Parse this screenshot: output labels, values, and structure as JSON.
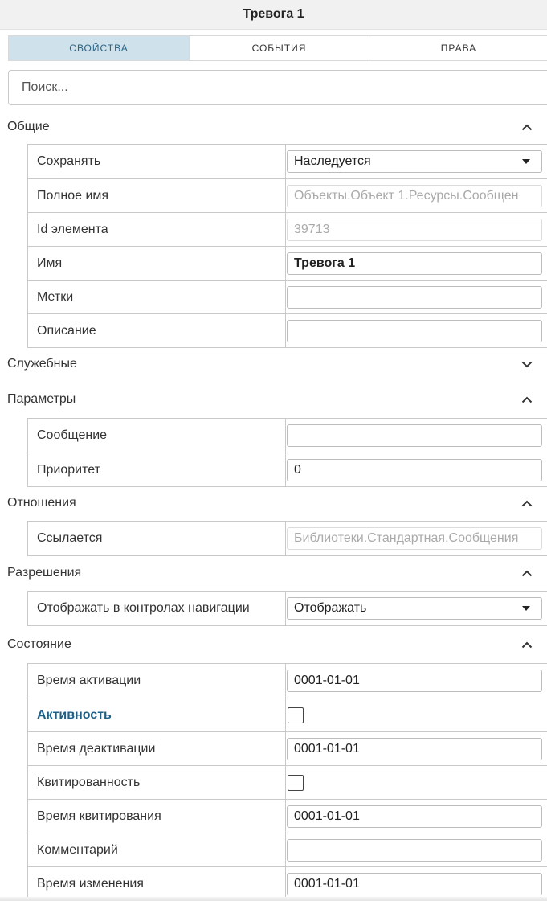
{
  "window": {
    "title": "Тревога 1"
  },
  "tabs": [
    {
      "label": "СВОЙСТВА"
    },
    {
      "label": "СОБЫТИЯ"
    },
    {
      "label": "ПРАВА"
    }
  ],
  "search": {
    "placeholder": "Поиск..."
  },
  "sections": {
    "general": {
      "title": "Общие",
      "expanded": true,
      "rows": {
        "save": {
          "label": "Сохранять",
          "value": "Наследуется"
        },
        "full_name": {
          "label": "Полное имя",
          "value": "Объекты.Объект 1.Ресурсы.Сообщен"
        },
        "element_id": {
          "label": "Id элемента",
          "value": "39713"
        },
        "name": {
          "label": "Имя",
          "value": "Тревога 1"
        },
        "tags": {
          "label": "Метки",
          "value": ""
        },
        "description": {
          "label": "Описание",
          "value": ""
        }
      }
    },
    "service": {
      "title": "Служебные",
      "expanded": false
    },
    "parameters": {
      "title": "Параметры",
      "expanded": true,
      "rows": {
        "message": {
          "label": "Сообщение",
          "value": ""
        },
        "priority": {
          "label": "Приоритет",
          "value": "0"
        }
      }
    },
    "relations": {
      "title": "Отношения",
      "expanded": true,
      "rows": {
        "refers": {
          "label": "Ссылается",
          "value": "Библиотеки.Стандартная.Сообщения"
        }
      }
    },
    "permissions": {
      "title": "Разрешения",
      "expanded": true,
      "rows": {
        "show_in_nav": {
          "label": "Отображать в контролах навигации",
          "value": "Отображать"
        }
      }
    },
    "state": {
      "title": "Состояние",
      "expanded": true,
      "rows": {
        "activation_time": {
          "label": "Время активации",
          "value": "0001-01-01"
        },
        "activity": {
          "label": "Активность",
          "checked": false
        },
        "deactivation_time": {
          "label": "Время деактивации",
          "value": "0001-01-01"
        },
        "acknowledged": {
          "label": "Квитированность",
          "checked": false
        },
        "ack_time": {
          "label": "Время квитирования",
          "value": "0001-01-01"
        },
        "comment": {
          "label": "Комментарий",
          "value": ""
        },
        "change_time": {
          "label": "Время изменения",
          "value": "0001-01-01"
        }
      }
    }
  },
  "icons": {
    "expanded": "chevron-up-icon",
    "collapsed": "chevron-down-icon",
    "dropdown": "caret-down-icon"
  },
  "colors": {
    "active_tab_bg": "#cfe2ec",
    "active_tab_text": "#2a6384",
    "accent_label": "#1d5f86"
  }
}
